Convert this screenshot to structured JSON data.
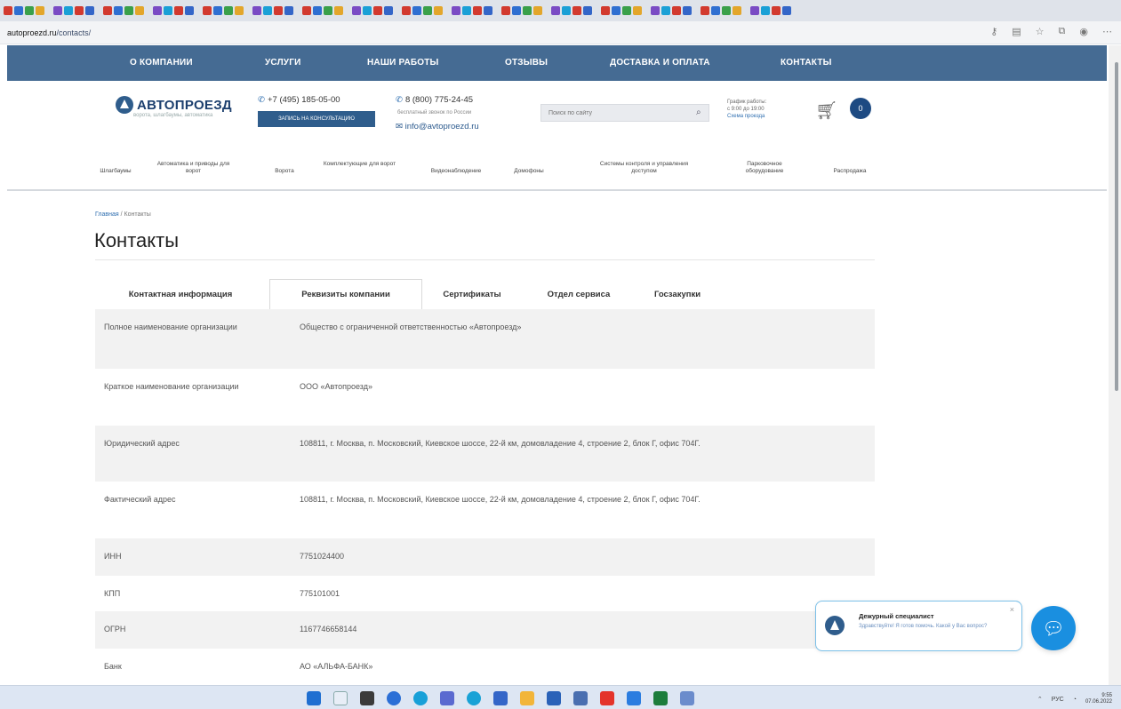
{
  "browser": {
    "url_host": "autoproezd.ru",
    "url_path": "/contacts/"
  },
  "nav": {
    "items": [
      "О КОМПАНИИ",
      "УСЛУГИ",
      "НАШИ РАБОТЫ",
      "ОТЗЫВЫ",
      "ДОСТАВКА И ОПЛАТА",
      "КОНТАКТЫ"
    ]
  },
  "header": {
    "logo_text": "АВТОПРОЕЗД",
    "logo_sub": "ворота, шлагбаумы, автоматика",
    "phone1": "+7 (495) 185-05-00",
    "consult_button": "ЗАПИСЬ НА КОНСУЛЬТАЦИЮ",
    "phone2": "8 (800) 775-24-45",
    "phone2_note": "бесплатный звонок по России",
    "email": "info@avtoproezd.ru",
    "search_placeholder": "Поиск по сайту",
    "hours_line1": "График работы:",
    "hours_line2": "с 9:00 до 19:00",
    "hours_link": "Схема проезда",
    "cart_count": "0"
  },
  "categories": [
    "Шлагбаумы",
    "Автоматика и приводы для ворот",
    "Ворота",
    "Комплектующие для ворот",
    "Видеонаблюдение",
    "Домофоны",
    "Системы контроля и управления доступом",
    "Парковочное оборудование",
    "Распродажа"
  ],
  "breadcrumb": {
    "home": "Главная",
    "separator": "/",
    "current": "Контакты"
  },
  "page_title": "Контакты",
  "tabs": [
    "Контактная информация",
    "Реквизиты компании",
    "Сертификаты",
    "Отдел сервиса",
    "Госзакупки"
  ],
  "details": [
    {
      "key": "Полное наименование организации",
      "value": "Общество с ограниченной ответственностью «Автопроезд»"
    },
    {
      "key": "Краткое наименование организации",
      "value": "ООО «Автопроезд»"
    },
    {
      "key": "Юридический адрес",
      "value": "108811, г. Москва, п. Московский, Киевское шоссе, 22-й км, домовладение 4, строение 2, блок Г, офис 704Г."
    },
    {
      "key": "Фактический адрес",
      "value": "108811, г. Москва, п. Московский, Киевское шоссе, 22-й км, домовладение 4, строение 2, блок Г, офис 704Г."
    },
    {
      "key": "ИНН",
      "value": "7751024400"
    },
    {
      "key": "КПП",
      "value": "775101001"
    },
    {
      "key": "ОГРН",
      "value": "1167746658144"
    },
    {
      "key": "Банк",
      "value": "АО «АЛЬФА-БАНК»"
    }
  ],
  "chat": {
    "title": "Дежурный специалист",
    "message": "Здравствуйте! Я готов помочь. Какой у Вас вопрос?"
  },
  "taskbar": {
    "lang": "РУС",
    "time": "9:55",
    "date": "07.06.2022"
  },
  "colors": {
    "nav_bg": "#456b93",
    "brand": "#1d4a82",
    "chat_button": "#1a8fe0"
  }
}
